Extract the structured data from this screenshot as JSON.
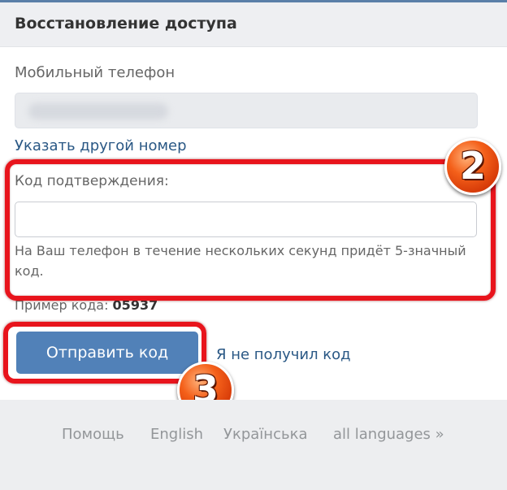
{
  "header": {
    "title": "Восстановление доступа"
  },
  "phone": {
    "label": "Мобильный телефон",
    "value": ""
  },
  "change_number_link": "Указать другой номер",
  "code": {
    "label": "Код подтверждения:",
    "value": "",
    "hint": "На Ваш телефон в течение нескольких секунд придёт 5-значный код.",
    "example_label": "Пример кода:",
    "example_value": "05937"
  },
  "actions": {
    "submit_label": "Отправить код",
    "not_received_label": "Я не получил код"
  },
  "annotations": {
    "badge_2": "2",
    "badge_3": "3",
    "frame_color": "#e8141c"
  },
  "footer": {
    "links": [
      "Помощь",
      "English",
      "Українська",
      "all languages »"
    ]
  },
  "colors": {
    "accent": "#5181b8",
    "link": "#2a5885",
    "header_bg": "#eeeff2"
  }
}
